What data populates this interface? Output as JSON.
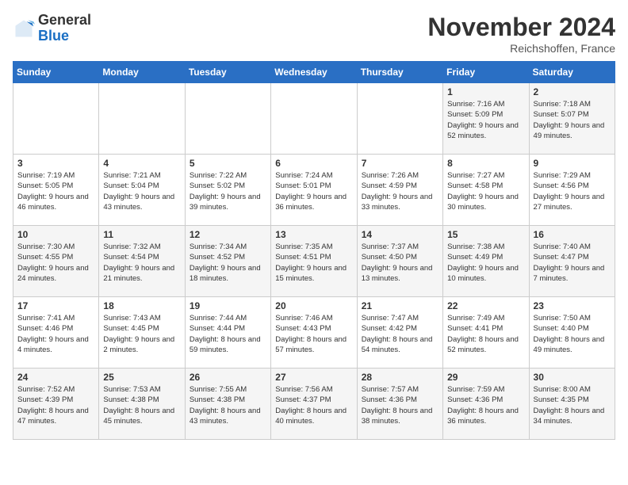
{
  "header": {
    "logo_general": "General",
    "logo_blue": "Blue",
    "month_title": "November 2024",
    "location": "Reichshoffen, France"
  },
  "columns": [
    "Sunday",
    "Monday",
    "Tuesday",
    "Wednesday",
    "Thursday",
    "Friday",
    "Saturday"
  ],
  "weeks": [
    [
      {
        "day": "",
        "info": ""
      },
      {
        "day": "",
        "info": ""
      },
      {
        "day": "",
        "info": ""
      },
      {
        "day": "",
        "info": ""
      },
      {
        "day": "",
        "info": ""
      },
      {
        "day": "1",
        "info": "Sunrise: 7:16 AM\nSunset: 5:09 PM\nDaylight: 9 hours and 52 minutes."
      },
      {
        "day": "2",
        "info": "Sunrise: 7:18 AM\nSunset: 5:07 PM\nDaylight: 9 hours and 49 minutes."
      }
    ],
    [
      {
        "day": "3",
        "info": "Sunrise: 7:19 AM\nSunset: 5:05 PM\nDaylight: 9 hours and 46 minutes."
      },
      {
        "day": "4",
        "info": "Sunrise: 7:21 AM\nSunset: 5:04 PM\nDaylight: 9 hours and 43 minutes."
      },
      {
        "day": "5",
        "info": "Sunrise: 7:22 AM\nSunset: 5:02 PM\nDaylight: 9 hours and 39 minutes."
      },
      {
        "day": "6",
        "info": "Sunrise: 7:24 AM\nSunset: 5:01 PM\nDaylight: 9 hours and 36 minutes."
      },
      {
        "day": "7",
        "info": "Sunrise: 7:26 AM\nSunset: 4:59 PM\nDaylight: 9 hours and 33 minutes."
      },
      {
        "day": "8",
        "info": "Sunrise: 7:27 AM\nSunset: 4:58 PM\nDaylight: 9 hours and 30 minutes."
      },
      {
        "day": "9",
        "info": "Sunrise: 7:29 AM\nSunset: 4:56 PM\nDaylight: 9 hours and 27 minutes."
      }
    ],
    [
      {
        "day": "10",
        "info": "Sunrise: 7:30 AM\nSunset: 4:55 PM\nDaylight: 9 hours and 24 minutes."
      },
      {
        "day": "11",
        "info": "Sunrise: 7:32 AM\nSunset: 4:54 PM\nDaylight: 9 hours and 21 minutes."
      },
      {
        "day": "12",
        "info": "Sunrise: 7:34 AM\nSunset: 4:52 PM\nDaylight: 9 hours and 18 minutes."
      },
      {
        "day": "13",
        "info": "Sunrise: 7:35 AM\nSunset: 4:51 PM\nDaylight: 9 hours and 15 minutes."
      },
      {
        "day": "14",
        "info": "Sunrise: 7:37 AM\nSunset: 4:50 PM\nDaylight: 9 hours and 13 minutes."
      },
      {
        "day": "15",
        "info": "Sunrise: 7:38 AM\nSunset: 4:49 PM\nDaylight: 9 hours and 10 minutes."
      },
      {
        "day": "16",
        "info": "Sunrise: 7:40 AM\nSunset: 4:47 PM\nDaylight: 9 hours and 7 minutes."
      }
    ],
    [
      {
        "day": "17",
        "info": "Sunrise: 7:41 AM\nSunset: 4:46 PM\nDaylight: 9 hours and 4 minutes."
      },
      {
        "day": "18",
        "info": "Sunrise: 7:43 AM\nSunset: 4:45 PM\nDaylight: 9 hours and 2 minutes."
      },
      {
        "day": "19",
        "info": "Sunrise: 7:44 AM\nSunset: 4:44 PM\nDaylight: 8 hours and 59 minutes."
      },
      {
        "day": "20",
        "info": "Sunrise: 7:46 AM\nSunset: 4:43 PM\nDaylight: 8 hours and 57 minutes."
      },
      {
        "day": "21",
        "info": "Sunrise: 7:47 AM\nSunset: 4:42 PM\nDaylight: 8 hours and 54 minutes."
      },
      {
        "day": "22",
        "info": "Sunrise: 7:49 AM\nSunset: 4:41 PM\nDaylight: 8 hours and 52 minutes."
      },
      {
        "day": "23",
        "info": "Sunrise: 7:50 AM\nSunset: 4:40 PM\nDaylight: 8 hours and 49 minutes."
      }
    ],
    [
      {
        "day": "24",
        "info": "Sunrise: 7:52 AM\nSunset: 4:39 PM\nDaylight: 8 hours and 47 minutes."
      },
      {
        "day": "25",
        "info": "Sunrise: 7:53 AM\nSunset: 4:38 PM\nDaylight: 8 hours and 45 minutes."
      },
      {
        "day": "26",
        "info": "Sunrise: 7:55 AM\nSunset: 4:38 PM\nDaylight: 8 hours and 43 minutes."
      },
      {
        "day": "27",
        "info": "Sunrise: 7:56 AM\nSunset: 4:37 PM\nDaylight: 8 hours and 40 minutes."
      },
      {
        "day": "28",
        "info": "Sunrise: 7:57 AM\nSunset: 4:36 PM\nDaylight: 8 hours and 38 minutes."
      },
      {
        "day": "29",
        "info": "Sunrise: 7:59 AM\nSunset: 4:36 PM\nDaylight: 8 hours and 36 minutes."
      },
      {
        "day": "30",
        "info": "Sunrise: 8:00 AM\nSunset: 4:35 PM\nDaylight: 8 hours and 34 minutes."
      }
    ]
  ]
}
